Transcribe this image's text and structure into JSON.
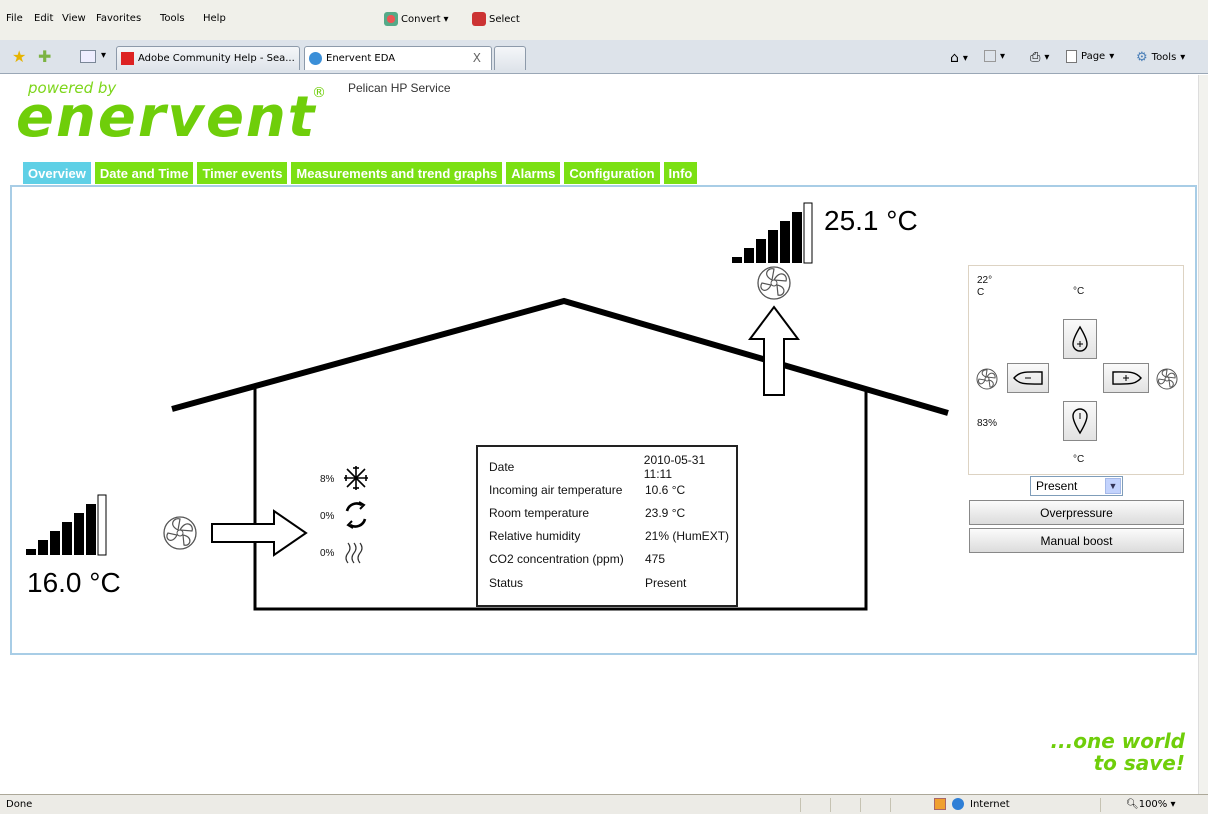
{
  "browser": {
    "menu": [
      "File",
      "Edit",
      "View",
      "Favorites",
      "Tools",
      "Help"
    ],
    "convert_label": "Convert",
    "select_label": "Select",
    "tabs": [
      {
        "label": "Adobe Community Help - Sea..."
      },
      {
        "label": "Enervent EDA"
      }
    ],
    "tab_close": "X",
    "page_label": "Page",
    "tools_label": "Tools",
    "status_text": "Done",
    "zone": "Internet",
    "zoom": "100%"
  },
  "header": {
    "powered_by": "powered by",
    "logo": "enervent",
    "registered": "®",
    "service_title": "Pelican HP Service"
  },
  "nav": {
    "tabs": [
      "Overview",
      "Date and Time",
      "Timer events",
      "Measurements and trend graphs",
      "Alarms",
      "Configuration",
      "Info"
    ],
    "active": "Overview"
  },
  "overview": {
    "outdoor_temp": "16.0 °C",
    "exhaust_temp": "25.1 °C",
    "outdoor_fan_level": 6,
    "exhaust_fan_level": 6,
    "cooling_pct": "8%",
    "recovery_pct": "0%",
    "heating_pct": "0%",
    "info": [
      {
        "label": "Date",
        "value": "2010-05-31 11:11"
      },
      {
        "label": "Incoming air temperature",
        "value": "10.6 °C"
      },
      {
        "label": "Room temperature",
        "value": "23.9 °C"
      },
      {
        "label": "Relative humidity",
        "value": "21% (HumEXT)"
      },
      {
        "label": "CO2 concentration (ppm)",
        "value": "475"
      },
      {
        "label": "Status",
        "value": "Present"
      }
    ]
  },
  "control": {
    "setpoint_line1": "22°",
    "setpoint_line2": "C",
    "unit_top": "°C",
    "unit_bottom": "°C",
    "fan_speed": "83%",
    "mode_value": "Present",
    "overpressure_label": "Overpressure",
    "manual_boost_label": "Manual boost"
  },
  "footer": {
    "slogan_line1": "...one world",
    "slogan_line2": "to save!"
  },
  "colors": {
    "brand_green": "#6fce0a",
    "nav_green": "#7be013",
    "nav_active": "#5fd0e6",
    "frame_border": "#a8cde6"
  }
}
